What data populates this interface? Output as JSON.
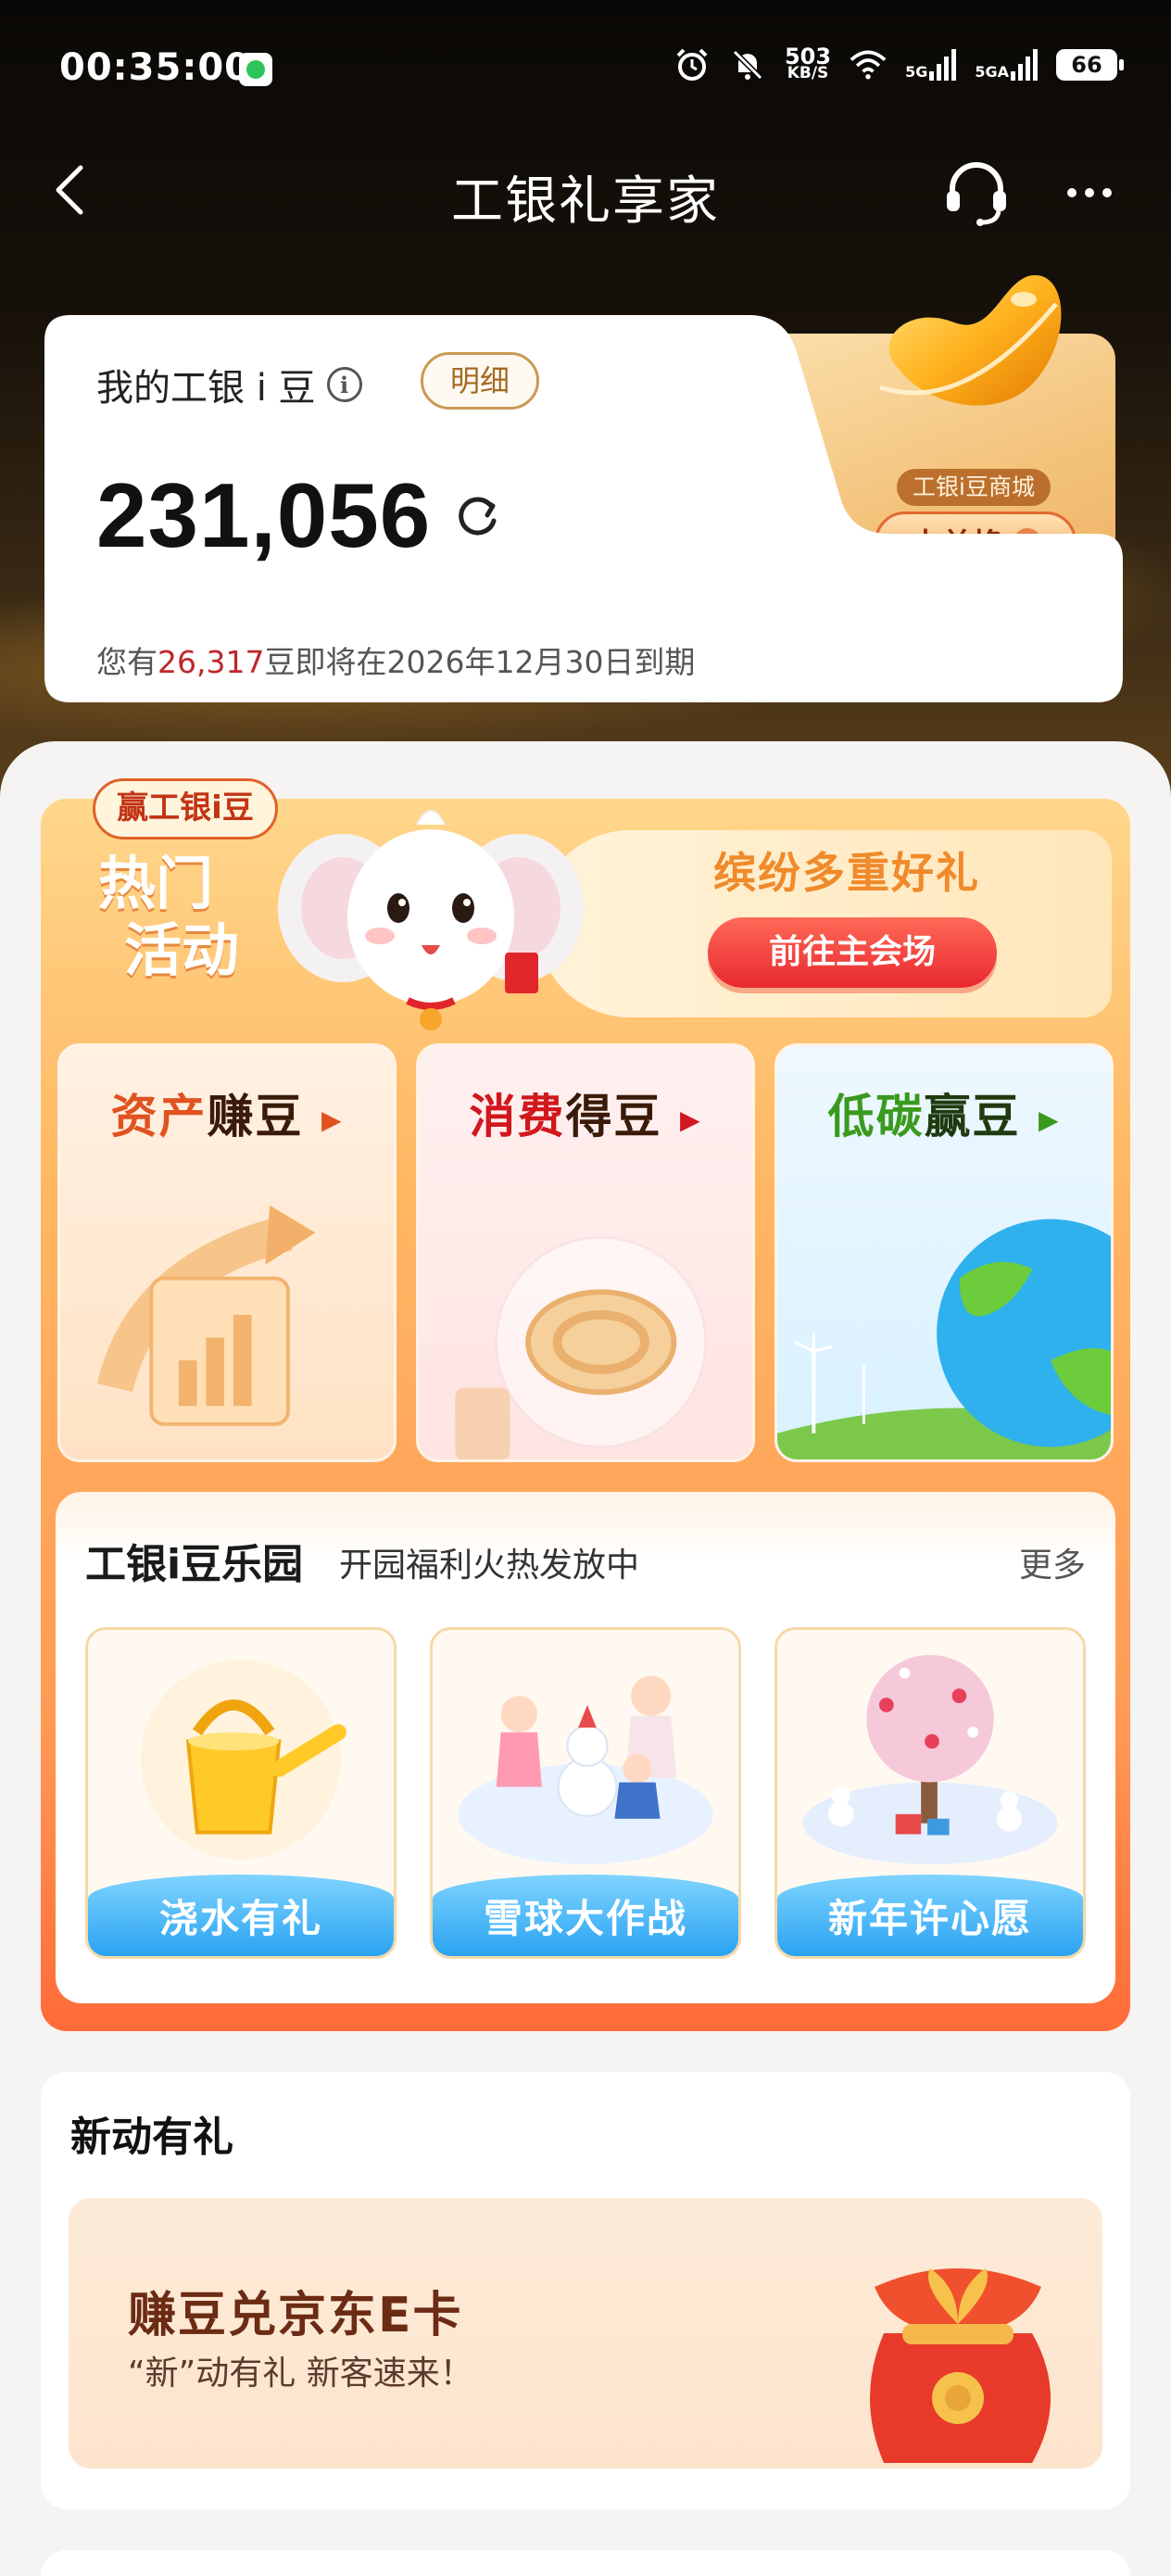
{
  "status_bar": {
    "time": "00:35:00",
    "net_speed_value": "503",
    "net_speed_unit": "KB/S",
    "signal1_label": "5G",
    "signal2_label": "5GA",
    "battery": "66"
  },
  "nav": {
    "title": "工银礼享家"
  },
  "points": {
    "title": "我的工银 i 豆",
    "detail_label": "明细",
    "value": "231,056",
    "expire_prefix": "您有",
    "expire_amount": "26,317",
    "expire_suffix": "豆即将在2026年12月30日到期",
    "mall_tag": "工银i豆商城",
    "exchange_label": "去兑换"
  },
  "hot_event": {
    "badge": "赢工银i豆",
    "title_line1": "热门",
    "title_line2": "活动",
    "gift_title": "缤纷多重好礼",
    "venue_button": "前往主会场"
  },
  "categories": [
    {
      "part1": "资产",
      "part2": "赚豆",
      "arrow": "▶",
      "color1": "#e0521f",
      "color2": "#3a1a08"
    },
    {
      "part1": "消费",
      "part2": "得豆",
      "arrow": "▶",
      "color1": "#d0181e",
      "color2": "#3a1a08"
    },
    {
      "part1": "低碳",
      "part2": "赢豆",
      "arrow": "▶",
      "color1": "#3a9a1e",
      "color2": "#1f3a10"
    }
  ],
  "park": {
    "title": "工银i豆乐园",
    "subtitle": "开园福利火热发放中",
    "more": "更多",
    "games": [
      {
        "label": "浇水有礼",
        "icon": "watering-can-icon"
      },
      {
        "label": "雪球大作战",
        "icon": "snowman-kids-icon"
      },
      {
        "label": "新年许心愿",
        "icon": "wish-tree-icon"
      }
    ]
  },
  "newbie": {
    "title": "新动有礼",
    "banner_title": "赚豆兑京东E卡",
    "banner_sub": "“新”动有礼 新客速来！"
  },
  "colors": {
    "accent_red": "#c0262a",
    "gold": "#c99a55",
    "promo_orange": "#ff9a55"
  }
}
